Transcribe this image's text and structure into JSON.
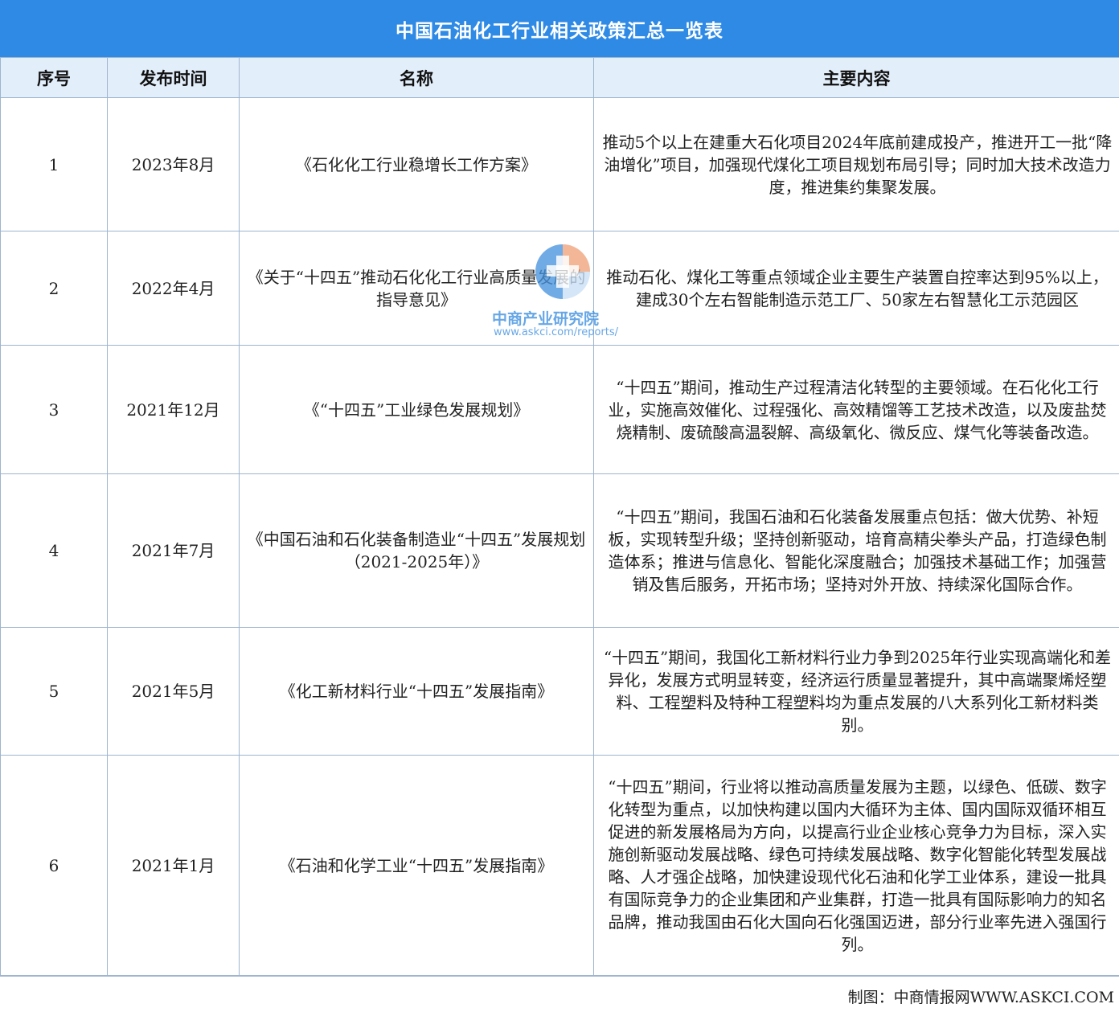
{
  "title": "中国石油化工行业相关政策汇总一览表",
  "headers": [
    "序号",
    "发布时间",
    "名称",
    "主要内容"
  ],
  "rows": [
    {
      "no": "1",
      "date": "2023年8月",
      "name": "《石化化工行业稳增长工作方案》",
      "content": "推动5个以上在建重大石化项目2024年底前建成投产，推进开工一批“降油增化”项目，加强现代煤化工项目规划布局引导；同时加大技术改造力度，推进集约集聚发展。"
    },
    {
      "no": "2",
      "date": "2022年4月",
      "name": "《关于“十四五”推动石化化工行业高质量发展的指导意见》",
      "content": "推动石化、煤化工等重点领域企业主要生产装置自控率达到95%以上，建成30个左右智能制造示范工厂、50家左右智慧化工示范园区"
    },
    {
      "no": "3",
      "date": "2021年12月",
      "name": "《“十四五”工业绿色发展规划》",
      "content": "“十四五”期间，推动生产过程清洁化转型的主要领域。在石化化工行业，实施高效催化、过程强化、高效精馏等工艺技术改造，以及废盐焚烧精制、废硫酸高温裂解、高级氧化、微反应、煤气化等装备改造。"
    },
    {
      "no": "4",
      "date": "2021年7月",
      "name": "《中国石油和石化装备制造业“十四五”发展规划（2021-2025年）》",
      "content": "“十四五”期间，我国石油和石化装备发展重点包括：做大优势、补短板，实现转型升级；坚持创新驱动，培育高精尖拳头产品，打造绿色制造体系；推进与信息化、智能化深度融合；加强技术基础工作；加强营销及售后服务，开拓市场；坚持对外开放、持续深化国际合作。"
    },
    {
      "no": "5",
      "date": "2021年5月",
      "name": "《化工新材料行业“十四五”发展指南》",
      "content": "“十四五”期间，我国化工新材料行业力争到2025年行业实现高端化和差异化，发展方式明显转变，经济运行质量显著提升，其中高端聚烯烃塑料、工程塑料及特种工程塑料均为重点发展的八大系列化工新材料类别。"
    },
    {
      "no": "6",
      "date": "2021年1月",
      "name": "《石油和化学工业“十四五”发展指南》",
      "content": "“十四五”期间，行业将以推动高质量发展为主题，以绿色、低碳、数字化转型为重点，以加快构建以国内大循环为主体、国内国际双循环相互促进的新发展格局为方向，以提高行业企业核心竞争力为目标，深入实施创新驱动发展战略、绿色可持续发展战略、数字化智能化转型发展战略、人才强企战略，加快建设现代化石油和化学工业体系，建设一批具有国际竞争力的企业集团和产业集群，打造一批具有国际影响力的知名品牌，推动我国由石化大国向石化强国迈进，部分行业率先进入强国行列。"
    }
  ],
  "footer": "制图：中商情报网WWW.ASKCI.COM",
  "watermark": {
    "name": "中商产业研究院",
    "url": "www.askci.com/reports/"
  },
  "colors": {
    "title_bg": "#2f8ae6",
    "header_bg": "#e3eefb",
    "border": "#9db5cf"
  }
}
